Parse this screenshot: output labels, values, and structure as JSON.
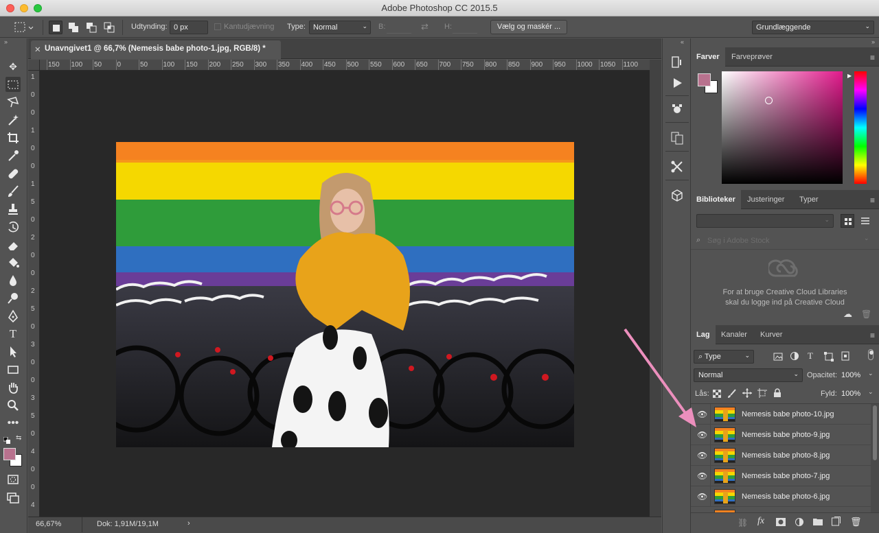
{
  "app": {
    "title": "Adobe Photoshop CC 2015.5"
  },
  "options_bar": {
    "feather_label": "Udtynding:",
    "feather_value": "0 px",
    "antialias_label": "Kantudjævning",
    "type_label": "Type:",
    "type_value": "Normal",
    "w_label": "B:",
    "h_label": "H:",
    "select_mask_button": "Vælg og maskér ...",
    "workspace_value": "Grundlæggende"
  },
  "document": {
    "tab_title": "Unavngivet1 @ 66,7% (Nemesis babe photo-1.jpg, RGB/8) *",
    "zoom": "66,67%",
    "doc_info": "Dok: 1,91M/19,1M"
  },
  "ruler": {
    "h_ticks": [
      "150",
      "100",
      "50",
      "0",
      "50",
      "100",
      "150",
      "200",
      "250",
      "300",
      "350",
      "400",
      "450",
      "500",
      "550",
      "600",
      "650",
      "700",
      "750",
      "800",
      "850",
      "900",
      "950",
      "1000",
      "1050",
      "1100"
    ],
    "v_ticks": [
      "1",
      "0",
      "0",
      "1",
      "0",
      "0",
      "1",
      "5",
      "0",
      "2",
      "0",
      "0",
      "2",
      "5",
      "0",
      "3",
      "0",
      "0",
      "3",
      "5",
      "0",
      "4",
      "0",
      "0",
      "4"
    ]
  },
  "color_panel": {
    "tabs": [
      "Farver",
      "Farveprøver"
    ],
    "foreground": "#b8728e",
    "background": "#ffffff"
  },
  "library_panel": {
    "tabs": [
      "Biblioteker",
      "Justeringer",
      "Typer"
    ],
    "search_placeholder": "Søg i Adobe Stock",
    "message_line1": "For at bruge Creative Cloud Libraries",
    "message_line2": "skal du logge ind på Creative Cloud"
  },
  "layers_panel": {
    "tabs": [
      "Lag",
      "Kanaler",
      "Kurver"
    ],
    "filter_value": "Type",
    "blend_mode": "Normal",
    "opacity_label": "Opacitet:",
    "opacity_value": "100%",
    "lock_label": "Lås:",
    "fill_label": "Fyld:",
    "fill_value": "100%",
    "layers": [
      {
        "name": "Nemesis babe photo-10.jpg"
      },
      {
        "name": "Nemesis babe photo-9.jpg"
      },
      {
        "name": "Nemesis babe photo-8.jpg"
      },
      {
        "name": "Nemesis babe photo-7.jpg"
      },
      {
        "name": "Nemesis babe photo-6.jpg"
      }
    ]
  },
  "colors": {
    "annotation_arrow": "#ec8fbd",
    "photo_stripes": [
      "#f58220",
      "#f5d800",
      "#2f9c3a",
      "#2f6fc0",
      "#6a3d98"
    ]
  }
}
